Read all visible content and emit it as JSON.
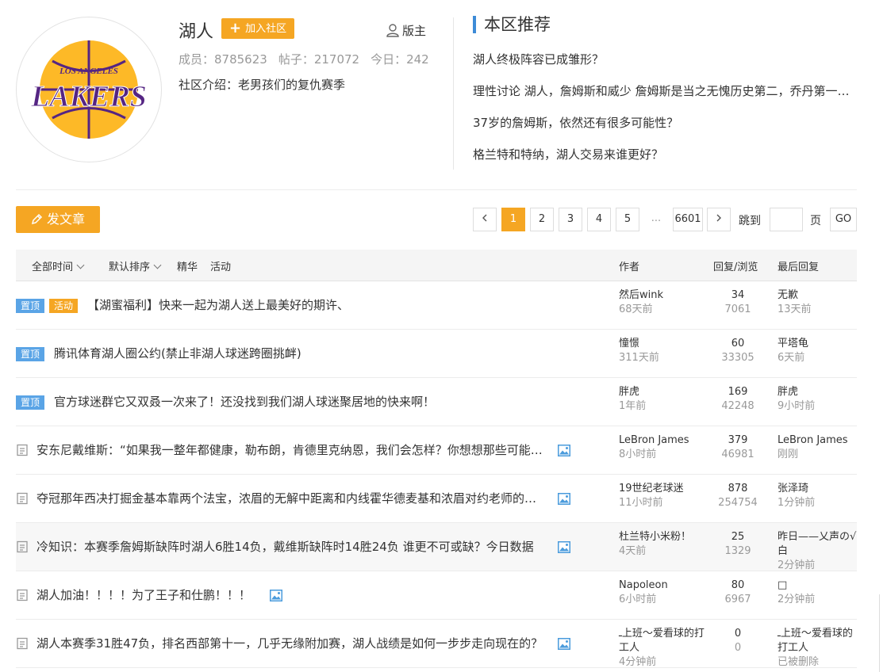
{
  "community": {
    "name": "湖人",
    "join_label": "加入社区",
    "moderator_label": "版主",
    "stats": {
      "members": "成员：8785623",
      "posts": "帖子：217072",
      "today": "今日：242"
    },
    "intro": "社区介绍：老男孩们的复仇赛季",
    "logo": {
      "top_text": "LOS ANGELES",
      "main_text": "LAKERS",
      "colors": {
        "gold": "#fdb927",
        "purple": "#552583"
      }
    }
  },
  "recommend": {
    "title": "本区推荐",
    "items": [
      "湖人终极阵容已成雏形？",
      "理性讨论 湖人，詹姆斯和威少 詹姆斯是当之无愧历史第二，乔丹第一，这是大部分人认可的",
      "37岁的詹姆斯，依然还有很多可能性？",
      "格兰特和特纳，湖人交易来谁更好？"
    ]
  },
  "toolbar": {
    "post_label": "发文章",
    "pages": [
      "1",
      "2",
      "3",
      "4",
      "5"
    ],
    "ellipsis": "...",
    "last_page": "6601",
    "jump_label": "跳到",
    "page_unit": "页",
    "go_label": "GO"
  },
  "table": {
    "filters": {
      "time": "全部时间",
      "sort": "默认排序",
      "featured": "精华",
      "activity": "活动"
    },
    "headers": {
      "author": "作者",
      "counts": "回复/浏览",
      "last": "最后回复"
    },
    "rows": [
      {
        "badges": [
          "置顶",
          "活动"
        ],
        "title": "【湖蜜福利】快来一起为湖人送上最美好的期许、",
        "author": "然后wink",
        "author_time": "68天前",
        "replies": "34",
        "views": "7061",
        "last_user": "无歉",
        "last_time": "13天前",
        "has_image": false
      },
      {
        "badges": [
          "置顶"
        ],
        "title": "腾讯体育湖人圈公约(禁止非湖人球迷跨圈挑衅)",
        "author": "憧憬",
        "author_time": "311天前",
        "replies": "60",
        "views": "33305",
        "last_user": "平塔龟",
        "last_time": "6天前",
        "has_image": false
      },
      {
        "badges": [
          "置顶"
        ],
        "title": "官方球迷群它又双叒一次来了！还没找到我们湖人球迷聚居地的快来啊！",
        "author": "胖虎",
        "author_time": "1年前",
        "replies": "169",
        "views": "42248",
        "last_user": "胖虎",
        "last_time": "9小时前",
        "has_image": false
      },
      {
        "badges": [],
        "title": "安东尼戴维斯：“如果我一整年都健康，勒布朗，肯德里克纳恩，我们会怎样？你想想那些可能性”",
        "author": "LeBron James",
        "author_time": "8小时前",
        "replies": "379",
        "views": "46981",
        "last_user": "LeBron James",
        "last_time": "刚刚",
        "has_image": true
      },
      {
        "badges": [],
        "title": "夺冠那年西决打掘金基本靠两个法宝，浓眉的无解中距离和内线霍华德麦基和浓眉对约老师的限制",
        "author": "19世纪老球迷",
        "author_time": "11小时前",
        "replies": "878",
        "views": "254754",
        "last_user": "张泽琦",
        "last_time": "1分钟前",
        "has_image": true
      },
      {
        "badges": [],
        "title": "冷知识：本赛季詹姆斯缺阵时湖人6胜14负，戴维斯缺阵时14胜24负 谁更不可或缺？今日数据",
        "author": "杜兰特小米粉！",
        "author_time": "4天前",
        "replies": "25",
        "views": "1329",
        "last_user": "昨日——乂声の√白",
        "last_time": "2分钟前",
        "has_image": true
      },
      {
        "badges": [],
        "title": "湖人加油！！！！为了王子和仕鹏！！！",
        "author": "Napoleon",
        "author_time": "6小时前",
        "replies": "80",
        "views": "6967",
        "last_user": "□",
        "last_time": "2分钟前",
        "has_image": true
      },
      {
        "badges": [],
        "title": "湖人本赛季31胜47负，排名西部第十一，几乎无缘附加赛，湖人战绩是如何一步步走向现在的？",
        "author": "ـ上班～爱看球的打工人",
        "author_time": "4分钟前",
        "replies": "0",
        "views": "0",
        "last_user": "ـ上班～爱看球的打工人",
        "last_time": "已被删除",
        "has_image": true
      }
    ]
  }
}
